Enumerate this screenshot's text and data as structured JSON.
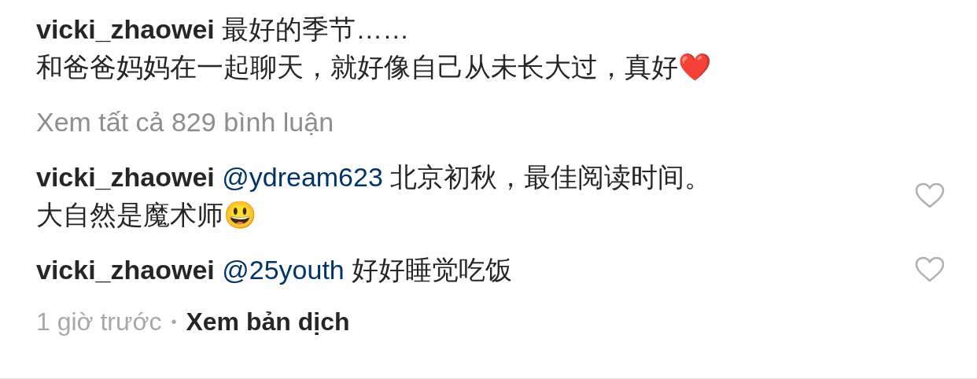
{
  "caption": {
    "username": "vicki_zhaowei",
    "lines": [
      "最好的季节……",
      "和爸爸妈妈在一起聊天，就好像自己从未长大过，真好❤️"
    ]
  },
  "view_all": "Xem tất cả 829 bình luận",
  "comments": [
    {
      "username": "vicki_zhaowei",
      "mention": "@ydream623",
      "lines": [
        "北京初秋，最佳阅读时间。",
        "大自然是魔术师😃"
      ],
      "liked": false
    },
    {
      "username": "vicki_zhaowei",
      "mention": "@25youth",
      "lines": [
        "好好睡觉吃饭"
      ],
      "liked": false
    }
  ],
  "meta": {
    "time": "1 giờ trước",
    "separator": "•",
    "translate": "Xem bản dịch"
  }
}
